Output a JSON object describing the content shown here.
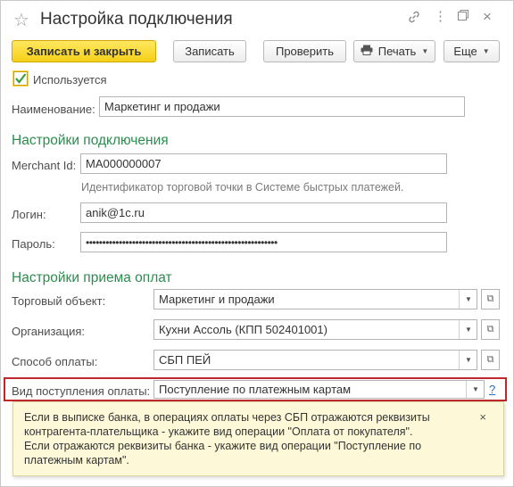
{
  "window": {
    "title": "Настройка подключения"
  },
  "toolbar": {
    "save_close_label": "Записать и закрыть",
    "save_label": "Записать",
    "check_label": "Проверить",
    "print_label": "Печать",
    "more_label": "Еще"
  },
  "form": {
    "used_label": "Используется",
    "used_checked": true,
    "name_label": "Наименование:",
    "name_value": "Маркетинг и продажи",
    "conn_section": "Настройки подключения",
    "merchant_label": "Merchant Id:",
    "merchant_value": "MA000000007",
    "merchant_hint": "Идентификатор торговой точки в Системе быстрых платежей.",
    "login_label": "Логин:",
    "login_value": "anik@1c.ru",
    "password_label": "Пароль:",
    "password_value": "••••••••••••••••••••••••••••••••••••••••••••••••••••••••••",
    "pay_section": "Настройки приема оплат",
    "trade_label": "Торговый объект:",
    "trade_value": "Маркетинг и продажи",
    "org_label": "Организация:",
    "org_value": "Кухни Ассоль (КПП 502401001)",
    "method_label": "Способ оплаты:",
    "method_value": "СБП ПЕЙ",
    "receipt_label": "Вид поступления оплаты:",
    "receipt_value": "Поступление по платежным картам",
    "help_mark": "?"
  },
  "tooltip": {
    "line1": "Если в выписке банка, в операциях оплаты через СБП отражаются реквизиты",
    "line2": "контрагента-плательщика - укажите вид операции \"Оплата от покупателя\".",
    "line3": "Если отражаются реквизиты банка - укажите вид операции \"Поступление по",
    "line4": "платежным картам\".",
    "close": "×"
  },
  "icons": [
    "star-icon",
    "link-icon",
    "more-vertical-icon",
    "restore-icon",
    "close-icon",
    "printer-icon",
    "dropdown-icon",
    "open-icon"
  ],
  "colors": {
    "primary_button": "#f5cf17",
    "section_title": "#2c8c4f",
    "highlight_border": "#c0272d",
    "tooltip_bg": "#fdf9d8"
  }
}
